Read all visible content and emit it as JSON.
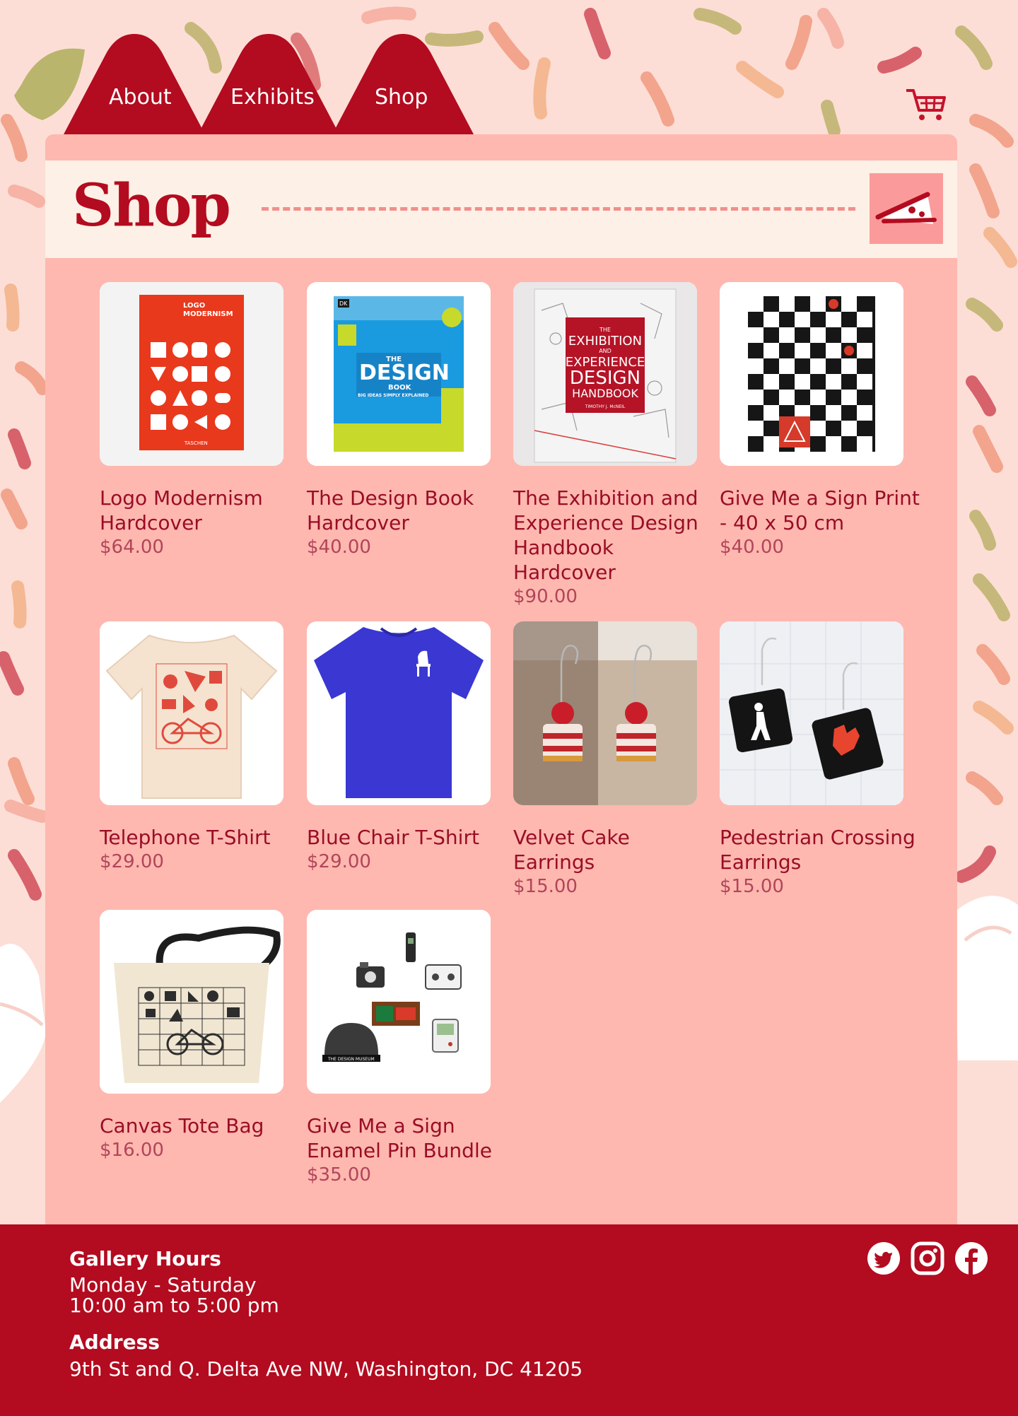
{
  "nav": {
    "items": [
      {
        "label": "About"
      },
      {
        "label": "Exhibits"
      },
      {
        "label": "Shop"
      }
    ],
    "cart_icon": "shopping-cart-icon"
  },
  "page": {
    "title": "Shop",
    "badge_icon": "pizza-slice-icon"
  },
  "products": [
    {
      "name": "Logo Modernism Hardcover",
      "price": "$64.00"
    },
    {
      "name": "The Design Book Hardcover",
      "price": "$40.00"
    },
    {
      "name": "The Exhibition and Experience Design Handbook Hardcover",
      "price": "$90.00"
    },
    {
      "name": "Give Me a Sign Print - 40 x 50 cm",
      "price": "$40.00"
    },
    {
      "name": "Telephone T-Shirt",
      "price": "$29.00"
    },
    {
      "name": "Blue Chair T-Shirt",
      "price": "$29.00"
    },
    {
      "name": "Velvet Cake Earrings",
      "price": "$15.00"
    },
    {
      "name": "Pedestrian Crossing Earrings",
      "price": "$15.00"
    },
    {
      "name": "Canvas Tote Bag",
      "price": "$16.00"
    },
    {
      "name": "Give Me a Sign Enamel Pin Bundle",
      "price": "$35.00"
    }
  ],
  "book_covers": {
    "logo_modernism": [
      "LOGO",
      "MODERNISM",
      "TASCHEN"
    ],
    "design_book": [
      "DK",
      "THE",
      "DESIGN",
      "BOOK",
      "BIG IDEAS SIMPLY EXPLAINED"
    ],
    "exhibition_handbook": [
      "THE",
      "EXHIBITION",
      "AND",
      "EXPERIENCE",
      "DESIGN",
      "HANDBOOK",
      "TIMOTHY J. McNEIL"
    ],
    "pin_bundle": [
      "THE DESIGN MUSEUM"
    ]
  },
  "footer": {
    "hours_heading": "Gallery Hours",
    "hours_days": "Monday - Saturday",
    "hours_time": "10:00 am to 5:00 pm",
    "address_heading": "Address",
    "address": "9th St and Q. Delta Ave NW, Washington, DC 41205",
    "social_icons": [
      "twitter-icon",
      "instagram-icon",
      "facebook-icon"
    ]
  },
  "colors": {
    "brand_red": "#b30b1f",
    "panel_pink": "#feb8b0",
    "background": "#fcded6",
    "header_cream": "#fdf0e6"
  }
}
